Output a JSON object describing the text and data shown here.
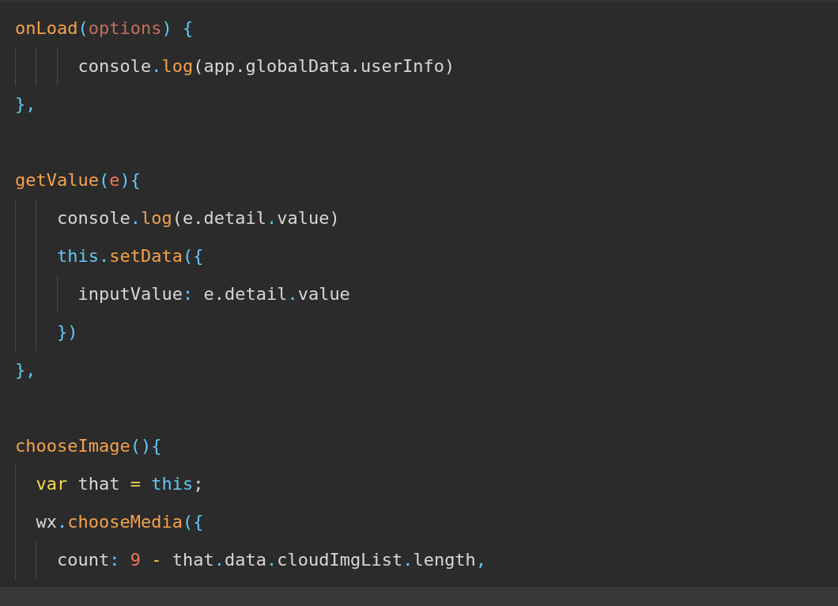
{
  "editor": {
    "lines": [
      {
        "kind": "code",
        "tokens": [
          {
            "text": "onLoad",
            "kind": "func"
          },
          {
            "text": "(",
            "kind": "punct"
          },
          {
            "text": "options",
            "kind": "param"
          },
          {
            "text": ") {",
            "kind": "punct"
          }
        ]
      },
      {
        "kind": "code",
        "tokens": [
          {
            "text": "      console",
            "kind": "plain"
          },
          {
            "text": ".",
            "kind": "punct"
          },
          {
            "text": "log",
            "kind": "func"
          },
          {
            "text": "(app.globalData.userInfo)",
            "kind": "plain"
          }
        ]
      },
      {
        "kind": "code",
        "tokens": [
          {
            "text": "},",
            "kind": "punct"
          }
        ]
      },
      {
        "kind": "blank"
      },
      {
        "kind": "code",
        "tokens": [
          {
            "text": "getValue",
            "kind": "func"
          },
          {
            "text": "(",
            "kind": "punct"
          },
          {
            "text": "e",
            "kind": "number"
          },
          {
            "text": "){",
            "kind": "punct"
          }
        ]
      },
      {
        "kind": "code",
        "tokens": [
          {
            "text": "    console",
            "kind": "plain"
          },
          {
            "text": ".",
            "kind": "punct"
          },
          {
            "text": "log",
            "kind": "func"
          },
          {
            "text": "(e.detail",
            "kind": "plain"
          },
          {
            "text": ".",
            "kind": "punct"
          },
          {
            "text": "value)",
            "kind": "plain"
          }
        ]
      },
      {
        "kind": "code",
        "tokens": [
          {
            "text": "    this",
            "kind": "keyword"
          },
          {
            "text": ".",
            "kind": "punct"
          },
          {
            "text": "setData",
            "kind": "func"
          },
          {
            "text": "({",
            "kind": "punct"
          }
        ]
      },
      {
        "kind": "code",
        "tokens": [
          {
            "text": "      inputValue",
            "kind": "plain"
          },
          {
            "text": ":",
            "kind": "punct"
          },
          {
            "text": " e.detail",
            "kind": "plain"
          },
          {
            "text": ".",
            "kind": "punct"
          },
          {
            "text": "value",
            "kind": "plain"
          }
        ]
      },
      {
        "kind": "code",
        "tokens": [
          {
            "text": "    })",
            "kind": "punct"
          }
        ]
      },
      {
        "kind": "code",
        "tokens": [
          {
            "text": "},",
            "kind": "punct"
          }
        ]
      },
      {
        "kind": "blank"
      },
      {
        "kind": "code",
        "tokens": [
          {
            "text": "chooseImage",
            "kind": "func"
          },
          {
            "text": "(){",
            "kind": "punct"
          }
        ]
      },
      {
        "kind": "code",
        "tokens": [
          {
            "text": "  var",
            "kind": "storage"
          },
          {
            "text": " that ",
            "kind": "plain"
          },
          {
            "text": "=",
            "kind": "operator"
          },
          {
            "text": " this",
            "kind": "keyword"
          },
          {
            "text": ";",
            "kind": "plain"
          }
        ]
      },
      {
        "kind": "code",
        "tokens": [
          {
            "text": "  wx",
            "kind": "plain"
          },
          {
            "text": ".",
            "kind": "punct"
          },
          {
            "text": "chooseMedia",
            "kind": "func"
          },
          {
            "text": "({",
            "kind": "punct"
          }
        ]
      },
      {
        "kind": "code",
        "tokens": [
          {
            "text": "    count",
            "kind": "plain"
          },
          {
            "text": ":",
            "kind": "punct"
          },
          {
            "text": " 9",
            "kind": "number"
          },
          {
            "text": " -",
            "kind": "operator"
          },
          {
            "text": " that",
            "kind": "plain"
          },
          {
            "text": ".",
            "kind": "punct"
          },
          {
            "text": "data",
            "kind": "plain"
          },
          {
            "text": ".",
            "kind": "punct"
          },
          {
            "text": "cloudImgList",
            "kind": "plain"
          },
          {
            "text": ".",
            "kind": "punct"
          },
          {
            "text": "length",
            "kind": "plain"
          },
          {
            "text": ",",
            "kind": "punct"
          }
        ]
      }
    ]
  }
}
